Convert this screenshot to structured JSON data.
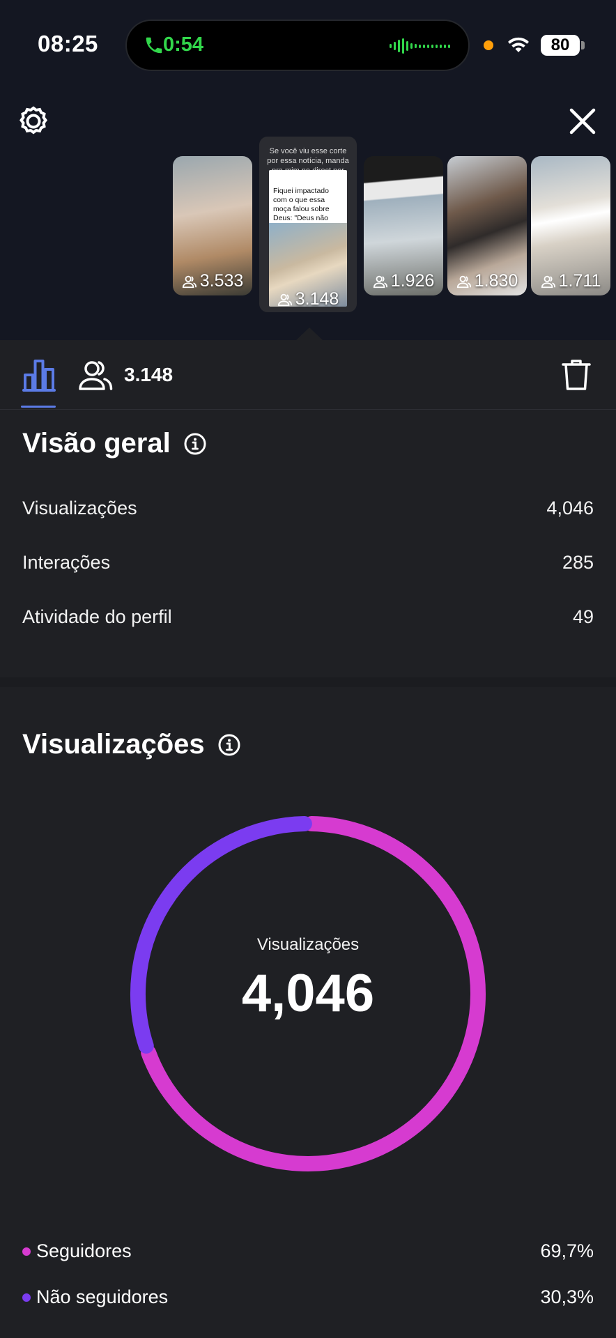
{
  "status_bar": {
    "time": "08:25",
    "call_duration": "0:54",
    "battery": "80"
  },
  "thumbnails": [
    {
      "count": "3.533"
    },
    {
      "count": "3.148",
      "selected": true,
      "caption": "Se você viu esse corte por essa notícia, manda pra mim no direct por favor 😂❤️",
      "card_text": "Fiquei impactado com o que essa moça falou sobre Deus: \"Deus não existe, ele é!\""
    },
    {
      "count": "1.926"
    },
    {
      "count": "1.830"
    },
    {
      "count": "1.711"
    }
  ],
  "toolbar": {
    "viewers_count": "3.148"
  },
  "overview": {
    "title": "Visão geral",
    "rows": [
      {
        "label": "Visualizações",
        "value": "4,046"
      },
      {
        "label": "Interações",
        "value": "285"
      },
      {
        "label": "Atividade do perfil",
        "value": "49"
      }
    ]
  },
  "views": {
    "title": "Visualizações",
    "donut_label": "Visualizações",
    "donut_value": "4,046",
    "legend": [
      {
        "label": "Seguidores",
        "value": "69,7%",
        "color": "#d63bd0"
      },
      {
        "label": "Não seguidores",
        "value": "30,3%",
        "color": "#7b3cf0"
      }
    ]
  },
  "chart_data": {
    "type": "pie",
    "categories": [
      "Seguidores",
      "Não seguidores"
    ],
    "values": [
      69.7,
      30.3
    ],
    "title": "Visualizações",
    "colors": [
      "#d63bd0",
      "#7b3cf0"
    ]
  }
}
